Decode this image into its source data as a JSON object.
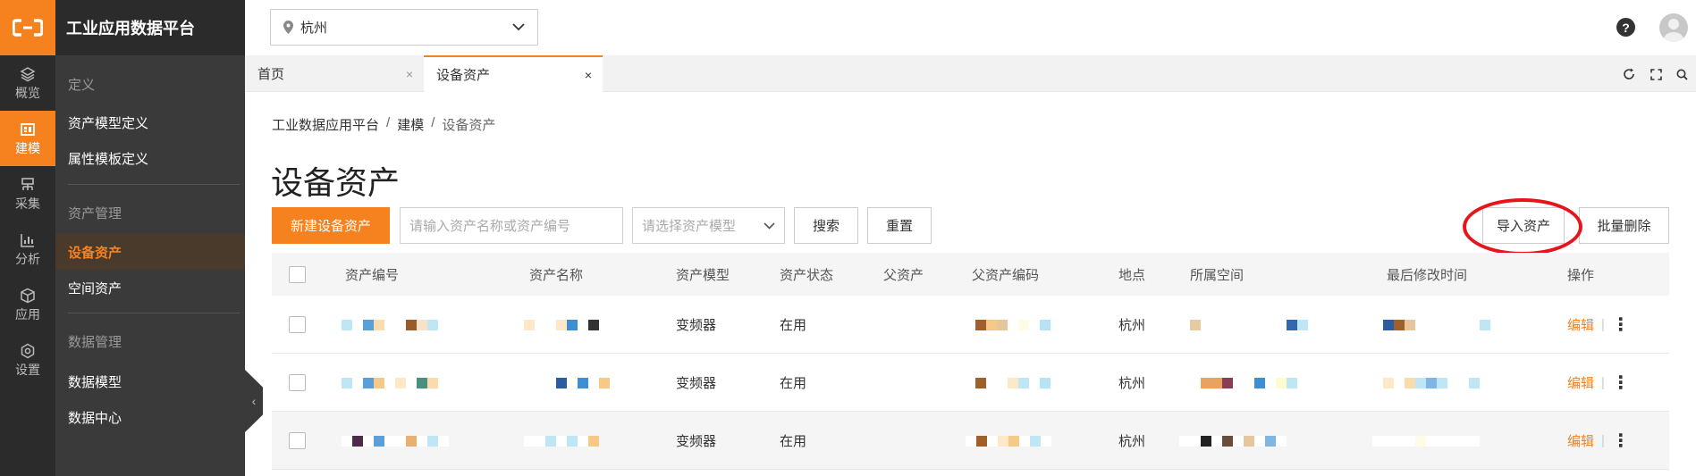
{
  "rail": {
    "items": [
      {
        "label": "概览",
        "icon": "layers-icon"
      },
      {
        "label": "建模",
        "icon": "model-icon"
      },
      {
        "label": "采集",
        "icon": "collect-icon"
      },
      {
        "label": "分析",
        "icon": "chart-icon"
      },
      {
        "label": "应用",
        "icon": "cube-icon"
      },
      {
        "label": "设置",
        "icon": "settings-icon"
      }
    ],
    "active": "建模"
  },
  "sidebar": {
    "title": "工业应用数据平台",
    "groups": [
      {
        "title": "定义",
        "items": [
          "资产模型定义",
          "属性模板定义"
        ]
      },
      {
        "title": "资产管理",
        "items": [
          "设备资产",
          "空间资产"
        ]
      },
      {
        "title": "数据管理",
        "items": [
          "数据模型",
          "数据中心"
        ]
      }
    ],
    "active_item": "设备资产"
  },
  "header": {
    "city": "杭州"
  },
  "tabs": [
    {
      "label": "首页",
      "active": false
    },
    {
      "label": "设备资产",
      "active": true
    }
  ],
  "breadcrumb": [
    "工业数据应用平台",
    "建模",
    "设备资产"
  ],
  "breadcrumb_sep": "/",
  "page_title": "设备资产",
  "toolbar": {
    "new_button": "新建设备资产",
    "search_placeholder": "请输入资产名称或资产编号",
    "model_placeholder": "请选择资产模型",
    "search_button": "搜索",
    "reset_button": "重置",
    "import_button": "导入资产",
    "bulk_delete_button": "批量删除"
  },
  "table": {
    "columns": [
      "资产编号",
      "资产名称",
      "资产模型",
      "资产状态",
      "父资产",
      "父资产编码",
      "地点",
      "所属空间",
      "最后修改时间",
      "操作"
    ],
    "rows": [
      {
        "model": "变频器",
        "status": "在用",
        "location": "杭州",
        "action": "编辑"
      },
      {
        "model": "变频器",
        "status": "在用",
        "location": "杭州",
        "action": "编辑"
      },
      {
        "model": "变频器",
        "status": "在用",
        "location": "杭州",
        "action": "编辑"
      }
    ]
  },
  "colors": {
    "accent": "#f5821f",
    "rail_bg": "#2b2b2b",
    "sidebar_bg": "#3a3a3a",
    "annotation_ring": "#e8141b"
  }
}
